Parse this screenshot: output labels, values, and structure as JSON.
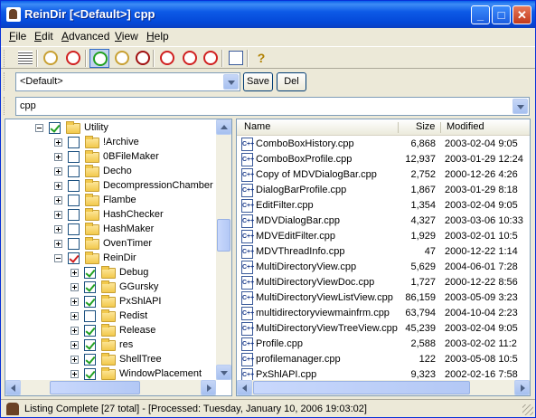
{
  "window": {
    "title": "ReinDir [<Default>] cpp"
  },
  "menu": [
    {
      "label": "File",
      "ul": "F",
      "rest": "ile"
    },
    {
      "label": "Edit",
      "ul": "E",
      "rest": "dit"
    },
    {
      "label": "Advanced",
      "ul": "A",
      "rest": "dvanced"
    },
    {
      "label": "View",
      "ul": "V",
      "rest": "iew"
    },
    {
      "label": "Help",
      "ul": "H",
      "rest": "elp"
    }
  ],
  "toolbar": {
    "icons": [
      "view-list-icon",
      "tree-icon",
      "no-filter-icon",
      "checked-tree-icon",
      "expand-tree-icon",
      "bug-icon",
      "cpp-filter-icon",
      "cpp-filter-2-icon",
      "cpp-filter-3-icon",
      "copy-icon",
      "help-icon"
    ],
    "active_index": 3
  },
  "profile": {
    "value": "<Default>",
    "save_label": "Save",
    "del_label": "Del"
  },
  "filter": {
    "value": "cpp"
  },
  "tree": [
    {
      "label": "Utility",
      "indent": 0,
      "expander": "minus",
      "checked": true,
      "red": false
    },
    {
      "label": "!Archive",
      "indent": 1,
      "expander": "plus",
      "checked": false,
      "red": false
    },
    {
      "label": "0BFileMaker",
      "indent": 1,
      "expander": "plus",
      "checked": false,
      "red": false
    },
    {
      "label": "Decho",
      "indent": 1,
      "expander": "plus",
      "checked": false,
      "red": false
    },
    {
      "label": "DecompressionChamber",
      "indent": 1,
      "expander": "plus",
      "checked": false,
      "red": false
    },
    {
      "label": "Flambe",
      "indent": 1,
      "expander": "plus",
      "checked": false,
      "red": false
    },
    {
      "label": "HashChecker",
      "indent": 1,
      "expander": "plus",
      "checked": false,
      "red": false
    },
    {
      "label": "HashMaker",
      "indent": 1,
      "expander": "plus",
      "checked": false,
      "red": false
    },
    {
      "label": "OvenTimer",
      "indent": 1,
      "expander": "plus",
      "checked": false,
      "red": false
    },
    {
      "label": "ReinDir",
      "indent": 1,
      "expander": "minus",
      "checked": true,
      "red": true
    },
    {
      "label": "Debug",
      "indent": 2,
      "expander": "plus",
      "checked": true,
      "red": false
    },
    {
      "label": "GGursky",
      "indent": 2,
      "expander": "plus",
      "checked": true,
      "red": false
    },
    {
      "label": "PxShlAPI",
      "indent": 2,
      "expander": "plus",
      "checked": true,
      "red": false
    },
    {
      "label": "Redist",
      "indent": 2,
      "expander": "plus",
      "checked": false,
      "red": false
    },
    {
      "label": "Release",
      "indent": 2,
      "expander": "plus",
      "checked": true,
      "red": false
    },
    {
      "label": "res",
      "indent": 2,
      "expander": "plus",
      "checked": true,
      "red": false
    },
    {
      "label": "ShellTree",
      "indent": 2,
      "expander": "plus",
      "checked": true,
      "red": false
    },
    {
      "label": "WindowPlacement",
      "indent": 2,
      "expander": "plus",
      "checked": true,
      "red": false
    }
  ],
  "list": {
    "columns": [
      "Name",
      "Size",
      "Modified"
    ],
    "icon_text": "C++",
    "rows": [
      {
        "name": "ComboBoxHistory.cpp",
        "size": "6,868",
        "modified": "2003-02-04 9:05"
      },
      {
        "name": "ComboBoxProfile.cpp",
        "size": "12,937",
        "modified": "2003-01-29 12:24"
      },
      {
        "name": "Copy of MDVDialogBar.cpp",
        "size": "2,752",
        "modified": "2000-12-26 4:26"
      },
      {
        "name": "DialogBarProfile.cpp",
        "size": "1,867",
        "modified": "2003-01-29 8:18"
      },
      {
        "name": "EditFilter.cpp",
        "size": "1,354",
        "modified": "2003-02-04 9:05"
      },
      {
        "name": "MDVDialogBar.cpp",
        "size": "4,327",
        "modified": "2003-03-06 10:33"
      },
      {
        "name": "MDVEditFilter.cpp",
        "size": "1,929",
        "modified": "2003-02-01 10:5"
      },
      {
        "name": "MDVThreadInfo.cpp",
        "size": "47",
        "modified": "2000-12-22 1:14"
      },
      {
        "name": "MultiDirectoryView.cpp",
        "size": "5,629",
        "modified": "2004-06-01 7:28"
      },
      {
        "name": "MultiDirectoryViewDoc.cpp",
        "size": "1,727",
        "modified": "2000-12-22 8:56"
      },
      {
        "name": "MultiDirectoryViewListView.cpp",
        "size": "86,159",
        "modified": "2003-05-09 3:23"
      },
      {
        "name": "multidirectoryviewmainfrm.cpp",
        "size": "63,794",
        "modified": "2004-10-04 2:23"
      },
      {
        "name": "MultiDirectoryViewTreeView.cpp",
        "size": "45,239",
        "modified": "2003-02-04 9:05"
      },
      {
        "name": "Profile.cpp",
        "size": "2,588",
        "modified": "2003-02-02 11:2"
      },
      {
        "name": "profilemanager.cpp",
        "size": "122",
        "modified": "2003-05-08 10:5"
      },
      {
        "name": "PxShlAPI.cpp",
        "size": "9,323",
        "modified": "2002-02-16 7:58"
      }
    ]
  },
  "status": {
    "text": "Listing Complete [27 total] - [Processed: Tuesday, January 10, 2006 19:03:02]"
  },
  "colors": {
    "title_bar": "#0a5fea",
    "selection": "#316ac5",
    "window_bg": "#ece9d8"
  }
}
